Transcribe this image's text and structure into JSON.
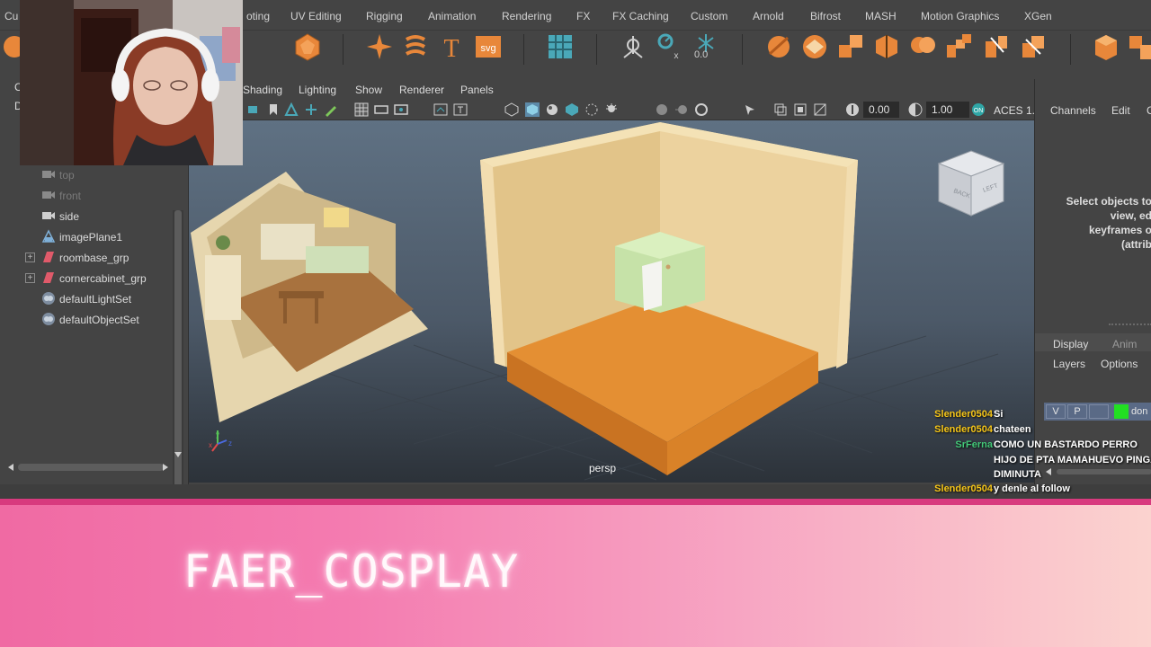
{
  "shelf_tabs": [
    "Cu",
    "oting",
    "UV Editing",
    "Rigging",
    "Animation",
    "Rendering",
    "FX",
    "FX Caching",
    "Custom",
    "Arnold",
    "Bifrost",
    "MASH",
    "Motion Graphics",
    "XGen"
  ],
  "shelf_icons": [
    "sphere-icon",
    "polyhedron-icon",
    "sparkle-icon",
    "sweep-icon",
    "text-type-icon",
    "svg-icon",
    "grid-icon",
    "locator-icon",
    "measure-icon",
    "snowflake-icon",
    "sculpt-icon",
    "uv-icon",
    "combine-icon",
    "separate-icon",
    "boolean-icon",
    "extract-icon",
    "mirror-icon",
    "bevel-icon",
    "cube-icon",
    "cubes-icon"
  ],
  "snow_value": "0.0",
  "panel_menu": [
    "Shading",
    "Lighting",
    "Show",
    "Renderer",
    "Panels"
  ],
  "toolbar": {
    "exposure": "0.00",
    "gamma": "1.00",
    "colorspace": "ACES 1."
  },
  "outliner_left_cut": [
    "C",
    "D"
  ],
  "outliner": [
    {
      "label": "top",
      "icon": "camera-icon",
      "dim": true
    },
    {
      "label": "front",
      "icon": "camera-icon",
      "dim": true
    },
    {
      "label": "side",
      "icon": "camera-icon",
      "dim": false
    },
    {
      "label": "imagePlane1",
      "icon": "image-plane-icon",
      "dim": false
    },
    {
      "label": "roombase_grp",
      "icon": "group-icon",
      "dim": false,
      "expand": true
    },
    {
      "label": "cornercabinet_grp",
      "icon": "group-icon",
      "dim": false,
      "expand": true
    },
    {
      "label": "defaultLightSet",
      "icon": "set-icon",
      "dim": false
    },
    {
      "label": "defaultObjectSet",
      "icon": "set-icon",
      "dim": false
    }
  ],
  "viewport": {
    "camera_label": "persp",
    "viewcube_left": "LEFT",
    "viewcube_back": "BACK"
  },
  "channel_box": {
    "tabs": [
      "Channels",
      "Edit",
      "C"
    ],
    "message": "Select objects to view, ed keyframes o (attrib",
    "layer_tabs": [
      "Display",
      "Anim"
    ],
    "layer_menu": [
      "Layers",
      "Options"
    ],
    "layer_buttons": [
      "V",
      "P"
    ],
    "layer_name": "don"
  },
  "chat": [
    {
      "user": "Slender0504",
      "color": "#f5c518",
      "msg": "Si"
    },
    {
      "user": "Slender0504",
      "color": "#f5c518",
      "msg": "chateen"
    },
    {
      "user": "SrFerna",
      "color": "#43c878",
      "msg": "COMO UN BASTARDO PERRO"
    },
    {
      "user": "",
      "color": "#43c878",
      "msg": "HIJO DE PTA MAMAHUEVO PINGA"
    },
    {
      "user": "",
      "color": "#43c878",
      "msg": "DIMINUTA"
    },
    {
      "user": "Slender0504",
      "color": "#f5c518",
      "msg": "y denle al follow"
    }
  ],
  "banner": {
    "name": "FAER_COSPLAY"
  }
}
